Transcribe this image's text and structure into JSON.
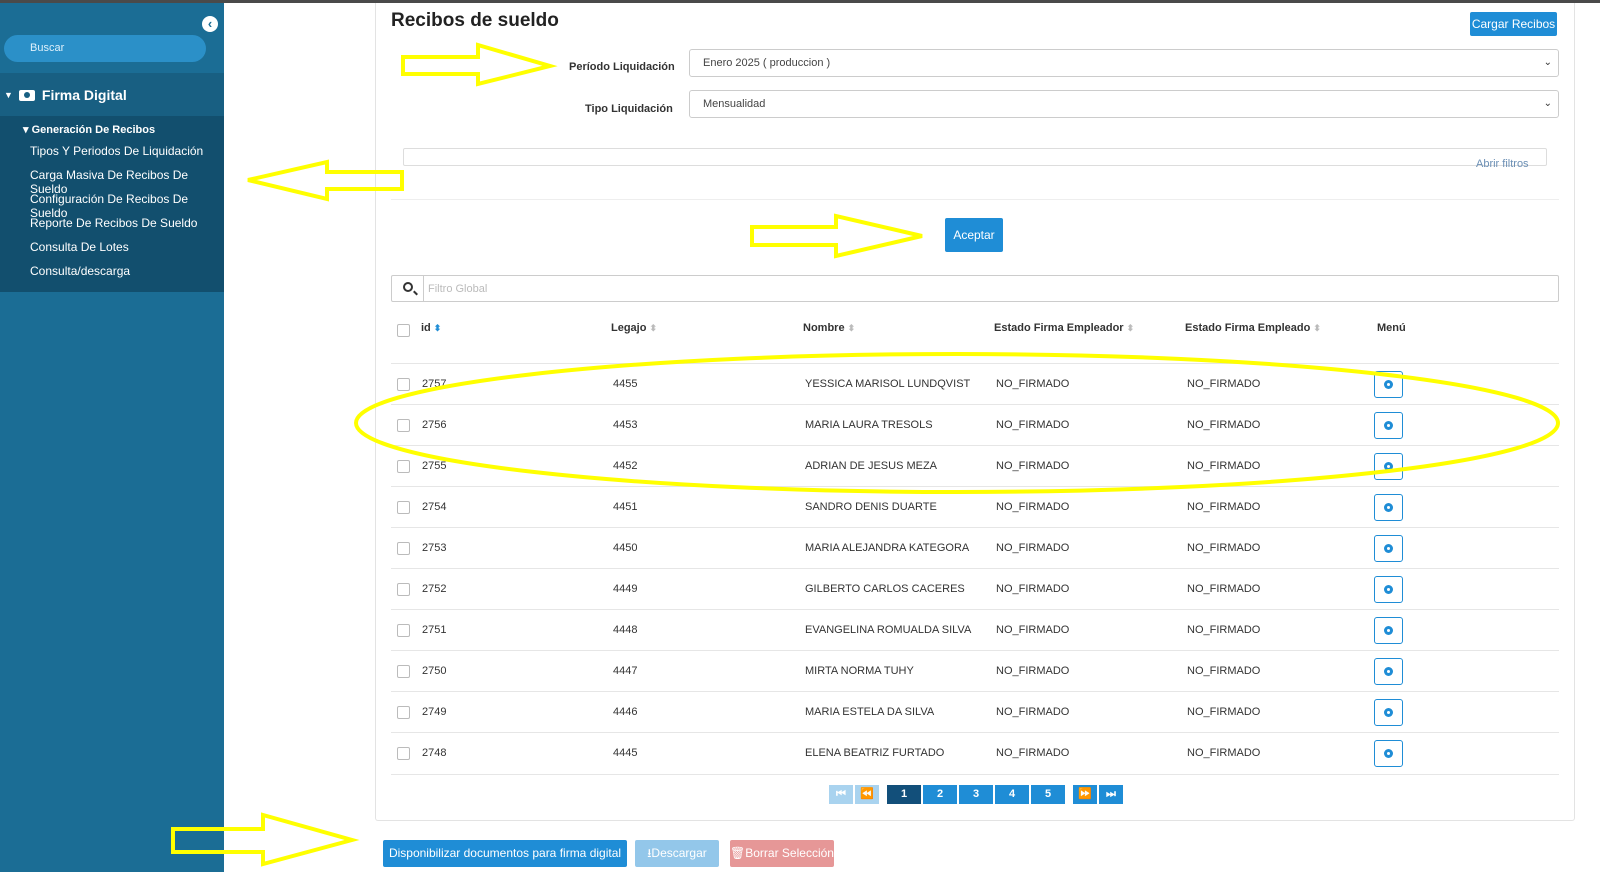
{
  "sidebar": {
    "search_placeholder": "Buscar",
    "section_title": "Firma Digital",
    "submenu_title": "Generación De Recibos",
    "items": [
      "Tipos Y Periodos De Liquidación",
      "Carga Masiva De Recibos De Sueldo",
      "Configuración De Recibos De Sueldo",
      "Reporte De Recibos De Sueldo",
      "Consulta De Lotes",
      "Consulta/descarga"
    ]
  },
  "page": {
    "title": "Recibos de sueldo",
    "upload_button": "Cargar Recibos"
  },
  "form": {
    "periodo_label": "Período Liquidación",
    "periodo_value": "Enero 2025 ( produccion )",
    "tipo_label": "Tipo Liquidación",
    "tipo_value": "Mensualidad",
    "open_filters": "Abrir filtros",
    "accept_button": "Aceptar"
  },
  "table": {
    "global_filter_placeholder": "Filtro Global",
    "columns": [
      "id",
      "Legajo",
      "Nombre",
      "Estado Firma Empleador",
      "Estado Firma Empleado",
      "Menú"
    ],
    "rows": [
      {
        "id": "2757",
        "legajo": "4455",
        "nombre": "YESSICA MARISOL LUNDQVIST",
        "empleador": "NO_FIRMADO",
        "empleado": "NO_FIRMADO"
      },
      {
        "id": "2756",
        "legajo": "4453",
        "nombre": "MARIA LAURA TRESOLS",
        "empleador": "NO_FIRMADO",
        "empleado": "NO_FIRMADO"
      },
      {
        "id": "2755",
        "legajo": "4452",
        "nombre": "ADRIAN DE JESUS MEZA",
        "empleador": "NO_FIRMADO",
        "empleado": "NO_FIRMADO"
      },
      {
        "id": "2754",
        "legajo": "4451",
        "nombre": "SANDRO DENIS DUARTE",
        "empleador": "NO_FIRMADO",
        "empleado": "NO_FIRMADO"
      },
      {
        "id": "2753",
        "legajo": "4450",
        "nombre": "MARIA ALEJANDRA KATEGORA",
        "empleador": "NO_FIRMADO",
        "empleado": "NO_FIRMADO"
      },
      {
        "id": "2752",
        "legajo": "4449",
        "nombre": "GILBERTO CARLOS CACERES",
        "empleador": "NO_FIRMADO",
        "empleado": "NO_FIRMADO"
      },
      {
        "id": "2751",
        "legajo": "4448",
        "nombre": "EVANGELINA ROMUALDA SILVA",
        "empleador": "NO_FIRMADO",
        "empleado": "NO_FIRMADO"
      },
      {
        "id": "2750",
        "legajo": "4447",
        "nombre": "MIRTA NORMA TUHY",
        "empleador": "NO_FIRMADO",
        "empleado": "NO_FIRMADO"
      },
      {
        "id": "2749",
        "legajo": "4446",
        "nombre": "MARIA ESTELA DA SILVA",
        "empleador": "NO_FIRMADO",
        "empleado": "NO_FIRMADO"
      },
      {
        "id": "2748",
        "legajo": "4445",
        "nombre": "ELENA BEATRIZ FURTADO",
        "empleador": "NO_FIRMADO",
        "empleado": "NO_FIRMADO"
      }
    ]
  },
  "pagination": {
    "pages": [
      "1",
      "2",
      "3",
      "4",
      "5"
    ],
    "current_page": "1"
  },
  "actions": {
    "publish_button": "Disponibilizar documentos para firma digital",
    "download_button": "Descargar",
    "clear_button": "Borrar Selección"
  },
  "colors": {
    "sidebar": "#1b6d95",
    "primary": "#1f8dd6",
    "annotation": "#ffff00"
  }
}
